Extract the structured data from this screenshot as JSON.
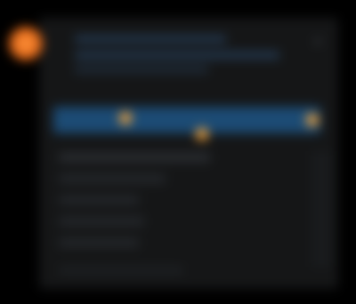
{
  "screen": {
    "note": "",
    "header": {
      "title": "",
      "subtitle": ""
    },
    "selected_row": {
      "label": ""
    },
    "list": {
      "items": [
        "",
        "",
        "",
        "",
        ""
      ]
    },
    "colors": {
      "background": "#000000",
      "panel": "#151617",
      "selection": "#1c4b74",
      "accent": "#e86a17",
      "badge": "#f2a23a"
    },
    "icons": [
      "app-logo-icon",
      "close-icon",
      "notification-badge-icon"
    ]
  }
}
